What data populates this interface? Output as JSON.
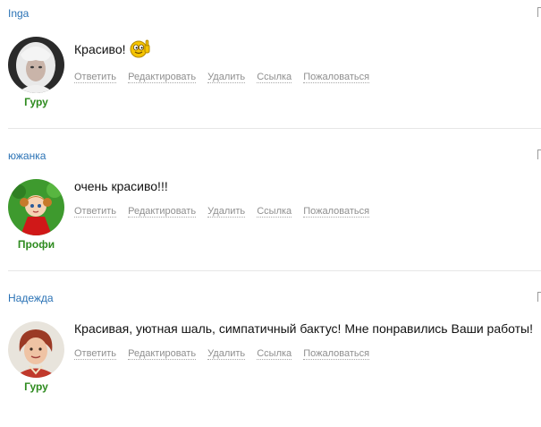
{
  "actions": {
    "reply": "Ответить",
    "edit": "Редактировать",
    "delete": "Удалить",
    "link": "Ссылка",
    "report": "Пожаловаться"
  },
  "comments": [
    {
      "author": "Inga",
      "rank": "Гуру",
      "text": "Красиво!",
      "emoticon": "thumbs-up-smiley-icon"
    },
    {
      "author": "южанка",
      "rank": "Профи",
      "text": "очень красиво!!!"
    },
    {
      "author": "Надежда",
      "rank": "Гуру",
      "text": "Красивая, уютная шаль, симпатичный бактус! Мне понравились Ваши работы!"
    }
  ],
  "colors": {
    "author_link": "#2a72b5",
    "rank": "#2e8b1f",
    "action_link": "#8f8f8f"
  }
}
